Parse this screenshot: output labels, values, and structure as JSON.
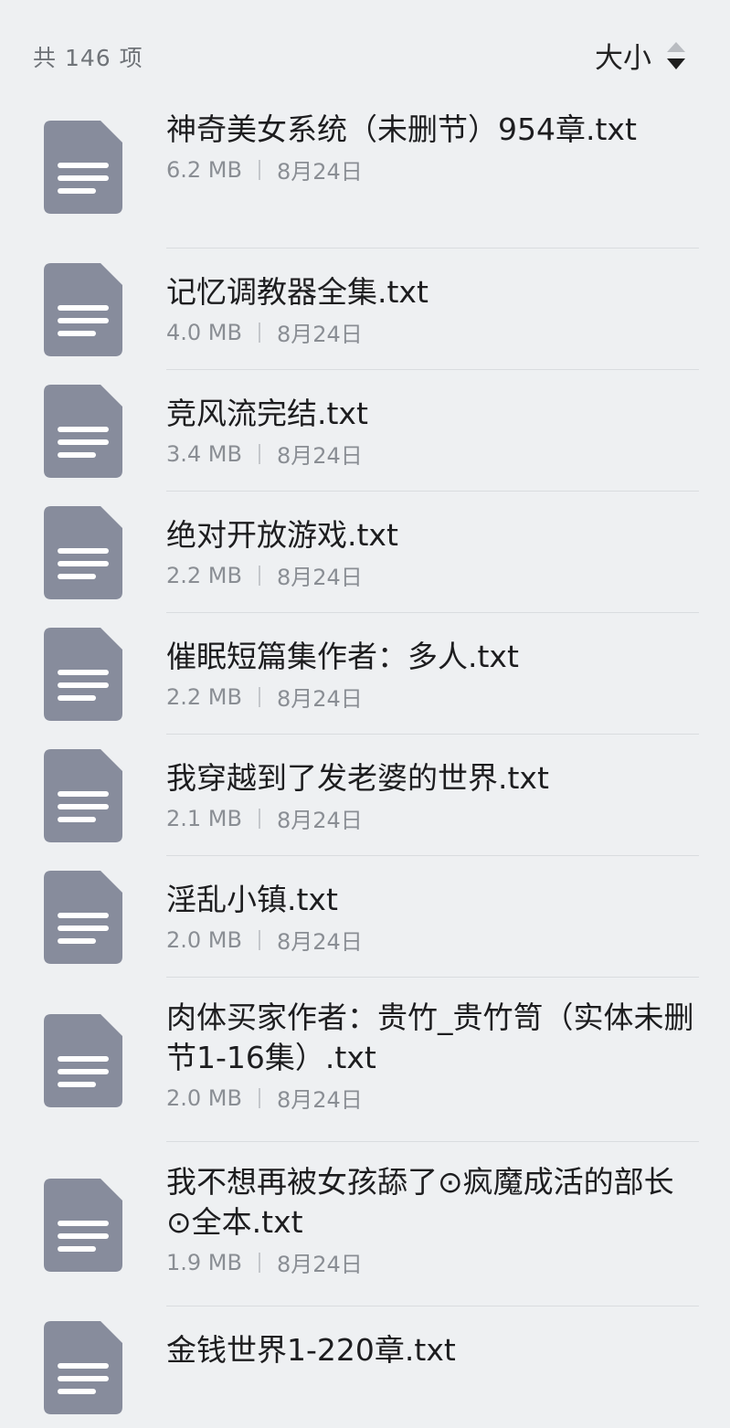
{
  "header": {
    "count_label": "共 146 项",
    "sort_label": "大小",
    "sort_icon": "sort-arrows-icon"
  },
  "files": [
    {
      "name": "神奇美女系统（未删节）954章.txt",
      "size": "6.2 MB",
      "date": "8月24日"
    },
    {
      "name": "记忆调教器全集.txt",
      "size": "4.0 MB",
      "date": "8月24日"
    },
    {
      "name": "竞风流完结.txt",
      "size": "3.4 MB",
      "date": "8月24日"
    },
    {
      "name": "绝对开放游戏.txt",
      "size": "2.2 MB",
      "date": "8月24日"
    },
    {
      "name": "催眠短篇集作者：多人.txt",
      "size": "2.2 MB",
      "date": "8月24日"
    },
    {
      "name": "我穿越到了发老婆的世界.txt",
      "size": "2.1 MB",
      "date": "8月24日"
    },
    {
      "name": "淫乱小镇.txt",
      "size": "2.0 MB",
      "date": "8月24日"
    },
    {
      "name": "肉体买家作者：贵竹_贵竹笥（实体未删节1-16集）.txt",
      "size": "2.0 MB",
      "date": "8月24日"
    },
    {
      "name": "我不想再被女孩舔了⊙疯魔成活的部长⊙全本.txt",
      "size": "1.9 MB",
      "date": "8月24日"
    },
    {
      "name": "金钱世界1-220章.txt",
      "size": "",
      "date": ""
    }
  ],
  "colors": {
    "background": "#eef0f2",
    "file_icon": "#878c9c",
    "file_icon_lines": "#ffffff"
  }
}
